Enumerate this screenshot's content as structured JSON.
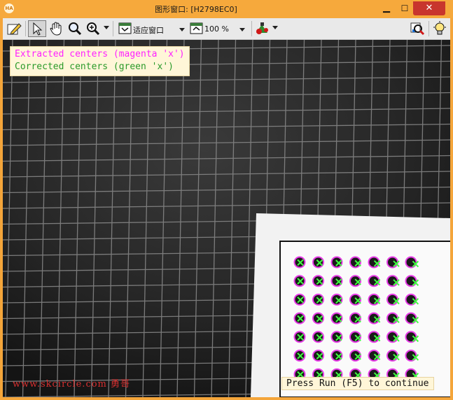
{
  "window": {
    "app_icon_text": "HA",
    "title": "图形窗口: [H2798EC0]",
    "minimize_glyph": "▁",
    "maximize_glyph": "☐",
    "close_glyph": "✕"
  },
  "toolbar": {
    "buttons": [
      {
        "name": "edit-pencil-icon"
      },
      {
        "name": "select-arrow-icon",
        "pressed": true
      },
      {
        "name": "pan-hand-icon"
      },
      {
        "name": "magnifier-icon"
      },
      {
        "name": "zoom-in-icon"
      }
    ],
    "fit_mode_label": "适应窗口",
    "zoom_value": "100 %",
    "right_buttons": [
      {
        "name": "color-tool-icon"
      },
      {
        "name": "inspect-icon"
      },
      {
        "name": "lightbulb-icon"
      }
    ]
  },
  "overlay": {
    "legend": {
      "line1": "Extracted centers (magenta 'x')",
      "line2": "Corrected centers (green 'x')"
    },
    "watermark": "www.skcircle.com 勇哥",
    "run_hint": "Press Run (F5) to continue"
  },
  "colors": {
    "title_bar": "#f6a93c",
    "legend_magenta": "#ff20ff",
    "legend_green": "#2a9a2a",
    "close_button": "#c8352d",
    "calibration_dot": "#1a1a1a",
    "dot_ring": "#e83ce8",
    "corrected_marker": "#40ff40"
  }
}
